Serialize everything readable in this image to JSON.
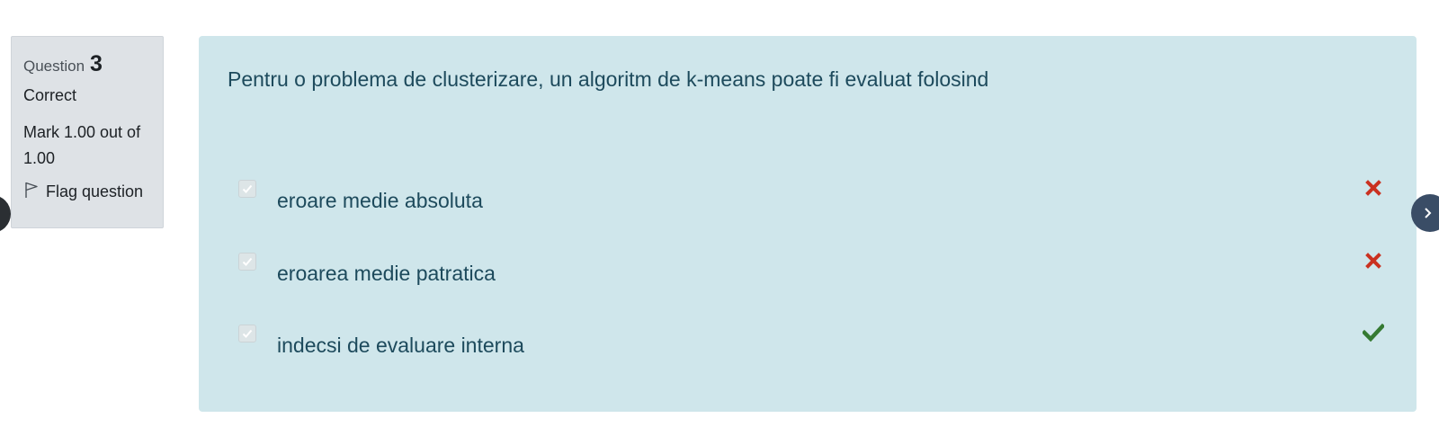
{
  "info": {
    "question_label": "Question",
    "question_number": "3",
    "state": "Correct",
    "grade": "Mark 1.00 out of 1.00",
    "flag_label": "Flag question"
  },
  "question": {
    "text": "Pentru o problema de clusterizare, un algoritm de k-means poate fi evaluat folosind",
    "answers": [
      {
        "label": "eroare medie absoluta",
        "checked": true,
        "result": "incorrect",
        "result_icon": "cross-icon"
      },
      {
        "label": "eroarea medie patratica",
        "checked": true,
        "result": "incorrect",
        "result_icon": "cross-icon"
      },
      {
        "label": "indecsi de evaluare interna",
        "checked": true,
        "result": "correct",
        "result_icon": "check-icon"
      }
    ]
  },
  "colors": {
    "info_bg": "#dee2e6",
    "content_bg": "#cfe6eb",
    "text": "#1d4a5c",
    "incorrect": "#ca3120",
    "correct": "#357a32",
    "nav_next": "#3a4d66"
  }
}
